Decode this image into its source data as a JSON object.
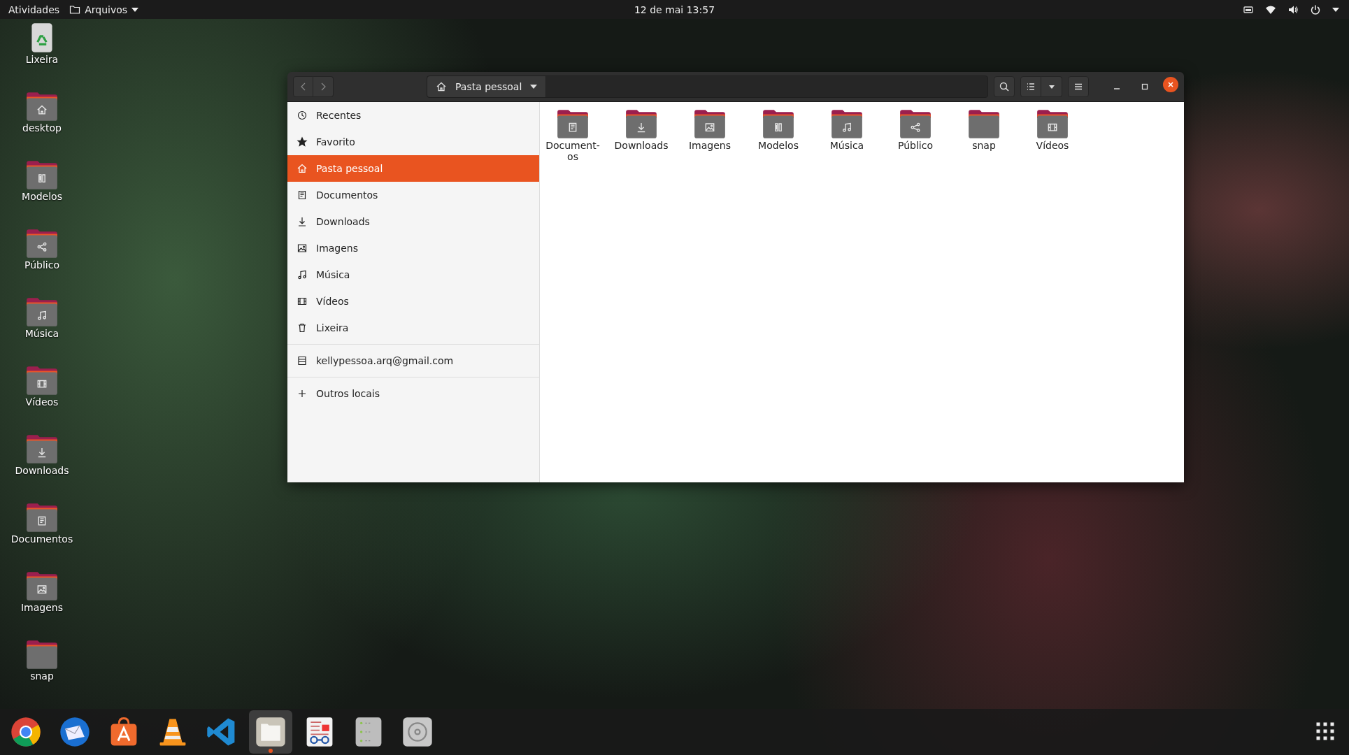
{
  "top_bar": {
    "activities": "Atividades",
    "app_menu": "Arquivos",
    "clock": "12 de mai  13:57"
  },
  "desktop_icons": [
    {
      "label": "Lixeira",
      "kind": "trash"
    },
    {
      "label": "desktop",
      "kind": "home"
    },
    {
      "label": "Modelos",
      "kind": "templates"
    },
    {
      "label": "Público",
      "kind": "share"
    },
    {
      "label": "Música",
      "kind": "music"
    },
    {
      "label": "Vídeos",
      "kind": "video"
    },
    {
      "label": "Downloads",
      "kind": "download"
    },
    {
      "label": "Documentos",
      "kind": "document"
    },
    {
      "label": "Imagens",
      "kind": "image"
    },
    {
      "label": "snap",
      "kind": "plain"
    }
  ],
  "window": {
    "location": "Pasta pessoal",
    "sidebar": {
      "items": [
        {
          "label": "Recentes",
          "kind": "clock",
          "selected": false
        },
        {
          "label": "Favorito",
          "kind": "star",
          "selected": false
        },
        {
          "label": "Pasta pessoal",
          "kind": "home",
          "selected": true
        },
        {
          "label": "Documentos",
          "kind": "document",
          "selected": false
        },
        {
          "label": "Downloads",
          "kind": "download",
          "selected": false
        },
        {
          "label": "Imagens",
          "kind": "image",
          "selected": false
        },
        {
          "label": "Música",
          "kind": "music",
          "selected": false
        },
        {
          "label": "Vídeos",
          "kind": "video",
          "selected": false
        },
        {
          "label": "Lixeira",
          "kind": "trash",
          "selected": false
        }
      ],
      "account": "kellypessoa.arq@gmail.com",
      "other_locations": "Outros locais"
    },
    "files": [
      {
        "label": "Document-\nos",
        "kind": "document"
      },
      {
        "label": "Downloads",
        "kind": "download"
      },
      {
        "label": "Imagens",
        "kind": "image"
      },
      {
        "label": "Modelos",
        "kind": "templates"
      },
      {
        "label": "Música",
        "kind": "music"
      },
      {
        "label": "Público",
        "kind": "share"
      },
      {
        "label": "snap",
        "kind": "plain"
      },
      {
        "label": "Vídeos",
        "kind": "video"
      }
    ]
  },
  "dock": [
    {
      "kind": "chrome",
      "active": false
    },
    {
      "kind": "mail",
      "active": false
    },
    {
      "kind": "store",
      "active": false
    },
    {
      "kind": "cone",
      "active": false
    },
    {
      "kind": "code",
      "active": false
    },
    {
      "kind": "files",
      "active": true
    },
    {
      "kind": "reader",
      "active": false
    },
    {
      "kind": "server",
      "active": false
    },
    {
      "kind": "disc",
      "active": false
    }
  ]
}
